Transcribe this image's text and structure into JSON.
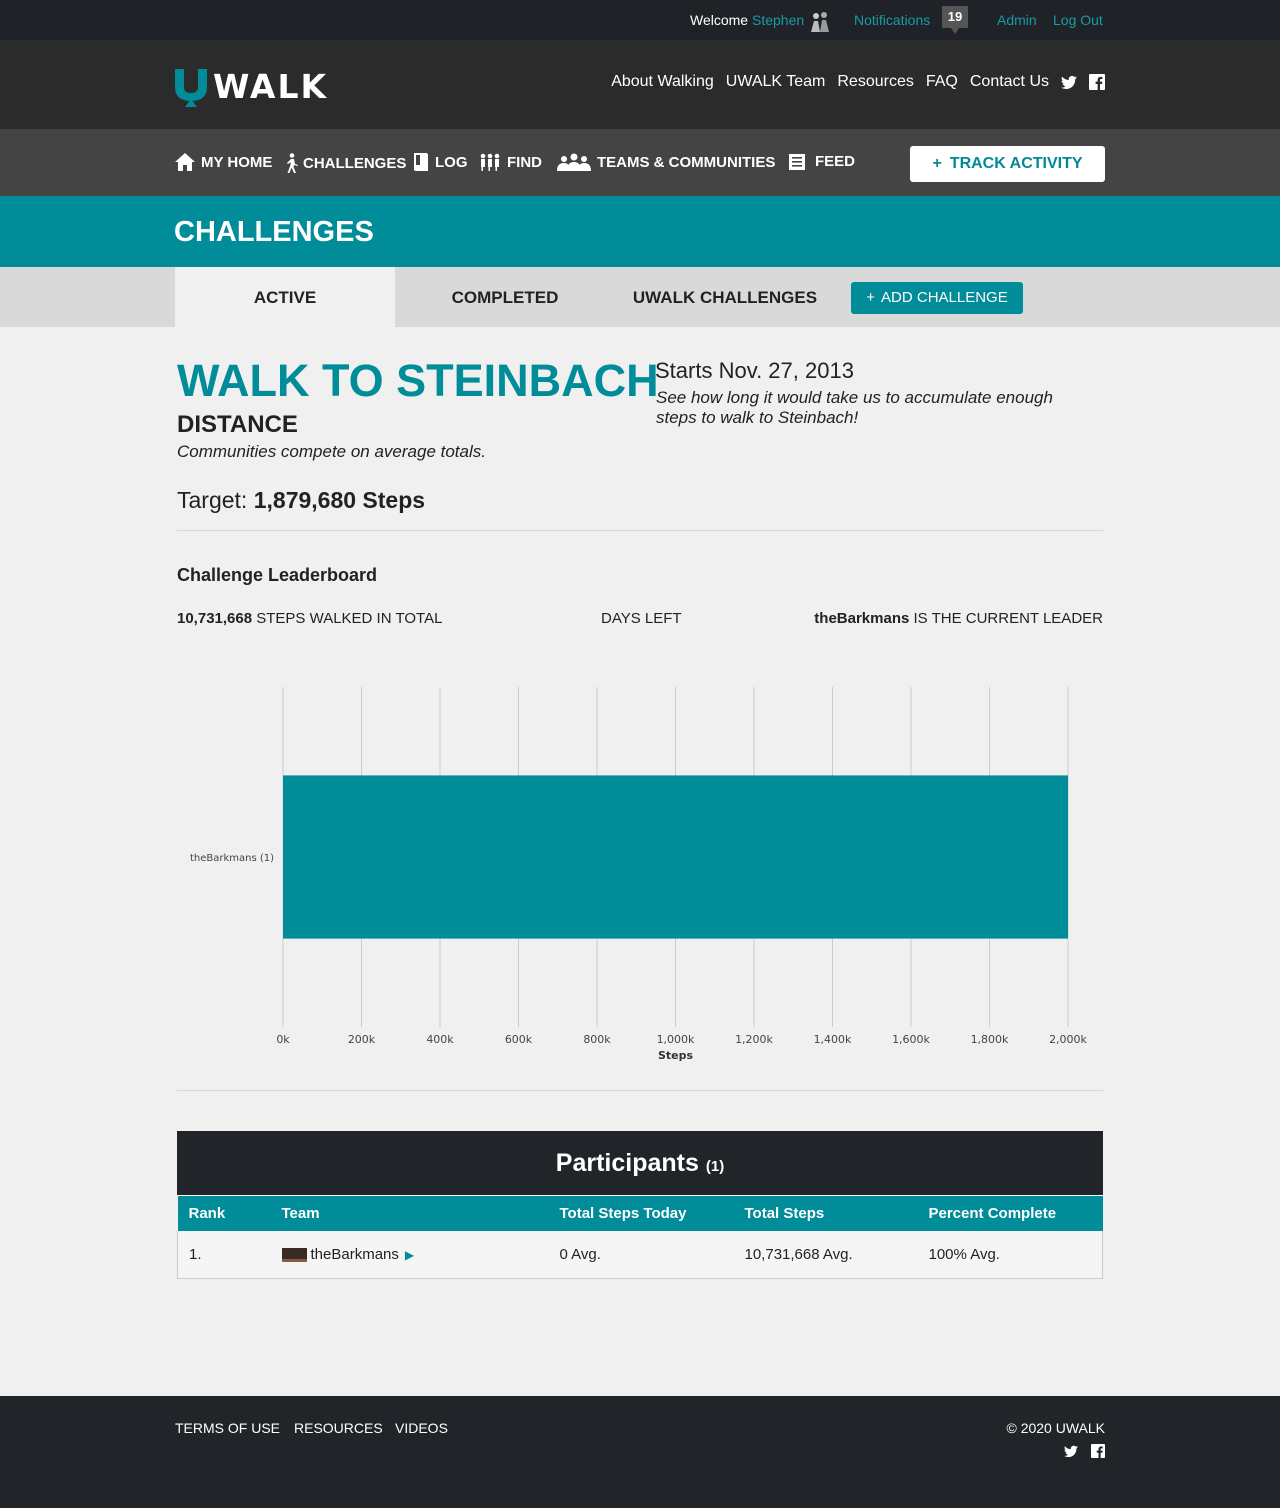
{
  "topbar": {
    "welcome": "Welcome",
    "username": "Stephen",
    "notifications_label": "Notifications",
    "notifications_count": "19",
    "admin": "Admin",
    "logout": "Log Out"
  },
  "header": {
    "logo_text": "WALK",
    "nav": [
      "About Walking",
      "UWALK Team",
      "Resources",
      "FAQ",
      "Contact Us"
    ],
    "social_icons": [
      "twitter-icon",
      "facebook-icon"
    ]
  },
  "mainnav": {
    "items": [
      {
        "label": "MY HOME",
        "icon": "home-icon"
      },
      {
        "label": "CHALLENGES",
        "icon": "walker-icon"
      },
      {
        "label": "LOG",
        "icon": "book-icon"
      },
      {
        "label": "FIND",
        "icon": "people-icon"
      },
      {
        "label": "TEAMS & COMMUNITIES",
        "icon": "group-icon"
      },
      {
        "label": "FEED",
        "icon": "list-icon"
      }
    ],
    "track_button": "TRACK ACTIVITY"
  },
  "page": {
    "title": "CHALLENGES"
  },
  "tabs": {
    "active": "ACTIVE",
    "completed": "COMPLETED",
    "uwalk": "UWALK CHALLENGES",
    "add": "ADD CHALLENGE"
  },
  "challenge": {
    "name": "WALK TO STEINBACH",
    "type": "DISTANCE",
    "subtitle": "Communities compete on average totals.",
    "target_label": "Target:",
    "target_value": "1,879,680 Steps",
    "starts": "Starts Nov. 27, 2013",
    "description": "See how long it would take us to accumulate enough steps to walk to Steinbach!"
  },
  "leaderboard": {
    "title": "Challenge Leaderboard",
    "total_steps": "10,731,668",
    "total_steps_label": "STEPS WALKED IN TOTAL",
    "days_left_label": "DAYS LEFT",
    "leader": "theBarkmans",
    "leader_label": "IS THE CURRENT LEADER"
  },
  "chart_data": {
    "type": "bar",
    "orientation": "horizontal",
    "categories": [
      "theBarkmans (1)"
    ],
    "values": [
      2000000
    ],
    "xlabel": "Steps",
    "xlim": [
      0,
      2000000
    ],
    "xticks": [
      "0k",
      "200k",
      "400k",
      "600k",
      "800k",
      "1,000k",
      "1,200k",
      "1,400k",
      "1,600k",
      "1,800k",
      "2,000k"
    ],
    "grid": true,
    "bar_color": "#008c99"
  },
  "participants": {
    "title": "Participants",
    "count": "(1)",
    "columns": [
      "Rank",
      "Team",
      "Total Steps Today",
      "Total Steps",
      "Percent Complete"
    ],
    "rows": [
      {
        "rank": "1.",
        "team": "theBarkmans",
        "today": "0 Avg.",
        "total": "10,731,668 Avg.",
        "percent": "100% Avg."
      }
    ]
  },
  "footer": {
    "links": [
      "TERMS OF USE",
      "RESOURCES",
      "VIDEOS"
    ],
    "copyright": "© 2020 UWALK"
  },
  "colors": {
    "accent": "#008c99",
    "dark": "#212428",
    "link": "#1a9aa6"
  }
}
